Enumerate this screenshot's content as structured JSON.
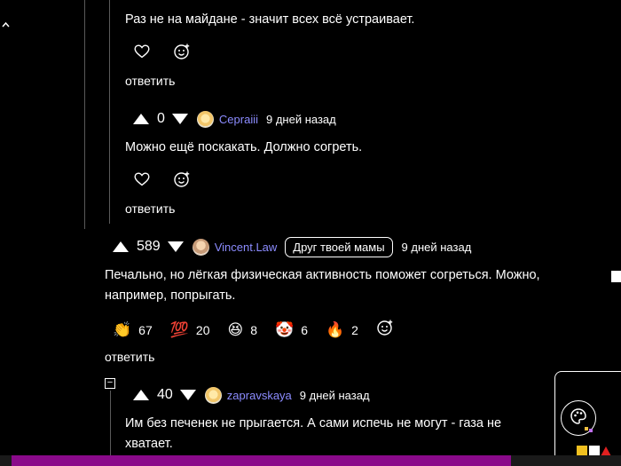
{
  "comments": [
    {
      "text": "Раз не на майдане - значит всех всё устраивает.",
      "reply_label": "ответить"
    },
    {
      "score": "0",
      "username": "Cepraiii",
      "time": "9 дней назад",
      "text": "Можно ещё поскакать. Должно согреть.",
      "reply_label": "ответить"
    },
    {
      "score": "589",
      "username": "Vincent.Law",
      "badge": "Друг твоей мамы",
      "time": "9 дней назад",
      "text_line1": "Печально, но лёгкая физическая активность поможет согреться. Можно,",
      "text_line2": "например, попрыгать.",
      "reactions": [
        {
          "emoji": "👏",
          "count": "67"
        },
        {
          "emoji": "💯",
          "count": "20"
        },
        {
          "emoji": "😆",
          "count": "8"
        },
        {
          "emoji": "🤡",
          "count": "6"
        },
        {
          "emoji": "🔥",
          "count": "2"
        }
      ],
      "reply_label": "ответить"
    },
    {
      "collapse_symbol": "−",
      "score": "40",
      "username": "zapravskaya",
      "time": "9 дней назад",
      "text_line1": "Им без печенек не прыгается. А сами испечь не могут - газа не",
      "text_line2": "хватает."
    }
  ],
  "colors": {
    "username": "#8c8cff",
    "scrollbar": "#8a0a8a"
  }
}
